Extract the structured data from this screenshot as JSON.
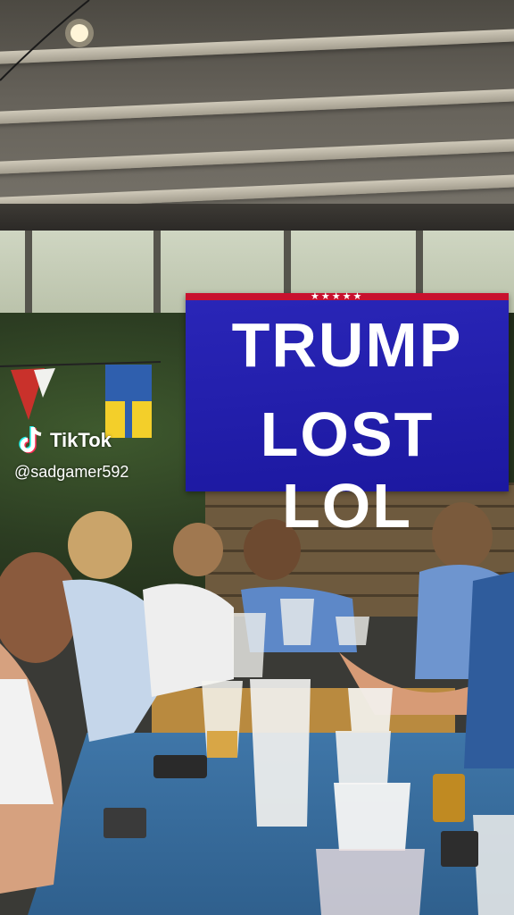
{
  "sign": {
    "line1": "TRUMP",
    "line2": "LOST LOL",
    "stars": "★★★★★",
    "background_color": "#1f1aa8",
    "stripe_color": "#c8102e"
  },
  "overlay": {
    "brand": "TikTok",
    "handle": "@sadgamer592",
    "logo_icon": "tiktok-note-icon"
  }
}
